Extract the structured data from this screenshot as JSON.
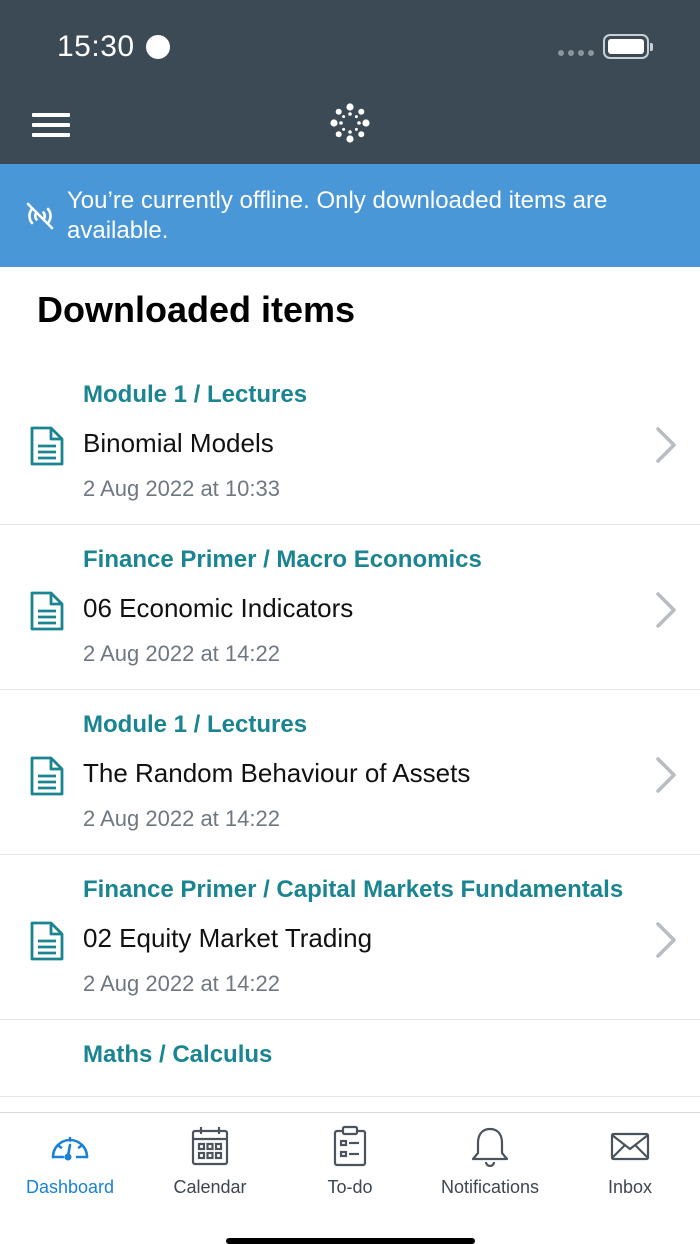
{
  "status_bar": {
    "time": "15:30"
  },
  "nav": {
    "menu_icon": "hamburger-icon",
    "logo_icon": "canvas-logo-icon"
  },
  "offline_banner": {
    "icon": "offline-signal-icon",
    "text": "You’re currently offline. Only downloaded items are available."
  },
  "page": {
    "title": "Downloaded items"
  },
  "items": [
    {
      "path": "Module 1 / Lectures",
      "title": "Binomial Models",
      "date": "2 Aug 2022 at 10:33"
    },
    {
      "path": "Finance Primer / Macro Economics",
      "title": "06 Economic Indicators",
      "date": "2 Aug 2022 at 14:22"
    },
    {
      "path": "Module 1 / Lectures",
      "title": "The Random Behaviour of Assets",
      "date": "2 Aug 2022 at 14:22"
    },
    {
      "path": "Finance Primer / Capital Markets Fundamentals",
      "title": "02 Equity Market Trading",
      "date": "2 Aug 2022 at 14:22"
    },
    {
      "path": "Maths / Calculus"
    }
  ],
  "tabs": [
    {
      "label": "Dashboard",
      "icon": "dashboard-gauge-icon",
      "active": true
    },
    {
      "label": "Calendar",
      "icon": "calendar-icon"
    },
    {
      "label": "To-do",
      "icon": "clipboard-icon"
    },
    {
      "label": "Notifications",
      "icon": "bell-icon"
    },
    {
      "label": "Inbox",
      "icon": "envelope-icon"
    }
  ],
  "colors": {
    "header_bg": "#3c4a55",
    "offline_bg": "#4a97d8",
    "accent_teal": "#1a8591",
    "tab_active": "#1a82d4"
  }
}
